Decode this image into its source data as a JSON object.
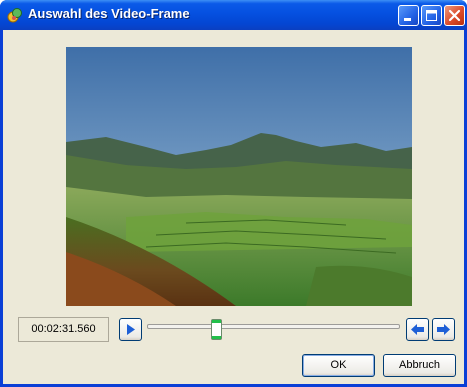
{
  "window": {
    "title": "Auswahl des Video-Frame"
  },
  "titlebar_buttons": {
    "minimize": "minimize-icon",
    "maximize": "maximize-icon",
    "close": "close-icon"
  },
  "controls": {
    "time": "00:02:31.560",
    "play": "play-icon",
    "prev": "arrow-left-icon",
    "next": "arrow-right-icon",
    "slider_position": 0.26
  },
  "buttons": {
    "ok": "OK",
    "cancel": "Abbruch"
  },
  "colors": {
    "titlebar": "#0550e0",
    "dialog_bg": "#ece9d8",
    "accent_blue": "#1e5fd6",
    "close_red": "#dc4b2a"
  }
}
